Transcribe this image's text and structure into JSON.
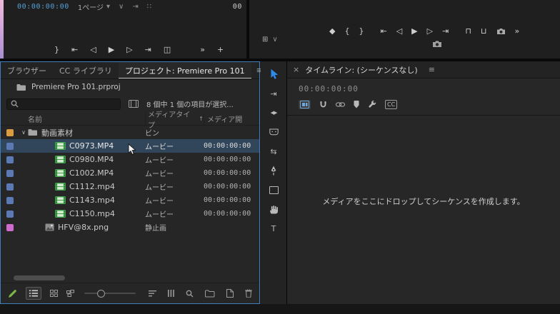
{
  "colors": {
    "accent": "#2d8ceb",
    "focus_border": "#3f7ebd",
    "timecode_blue": "#56a0d6",
    "selected_row": "#31465a",
    "swatch_bin": "#dd9b3f",
    "swatch_movie": "#5a79b5",
    "swatch_still": "#cf6bcf",
    "tool_green": "#7ab648"
  },
  "glyphs": {
    "chevron_down": "∨",
    "caret_down": "▾",
    "overflow": "»",
    "plus": "+",
    "menu": "≡",
    "close": "×",
    "brace_open": "{",
    "brace_close": "}",
    "go_to_in": "⇤",
    "go_to_out": "⇥",
    "step_back": "◁",
    "step_forward": "▷",
    "play": "▶",
    "marker": "◆",
    "lift": "⊓",
    "extract": "⊔",
    "insert": "◫",
    "grid": "⊞",
    "dots": "∷",
    "sort_up": "↑",
    "track_select": "⇥",
    "ripple": "◀▶",
    "slip": "⇆",
    "type_tool": "T"
  },
  "source_monitor": {
    "timecode": "00:00:00:00",
    "page_select": "1ページ",
    "duration": "00"
  },
  "project": {
    "tabs": [
      {
        "label": "ブラウザー"
      },
      {
        "label": "CC ライブラリ"
      },
      {
        "label": "プロジェクト: Premiere Pro 101"
      }
    ],
    "breadcrumb": "Premiere Pro 101.prproj",
    "search_value": "",
    "status": "8 個中 1 個の項目が選択...",
    "columns": {
      "name": "名前",
      "type": "メディアタイプ",
      "start": "メディア開"
    },
    "items": [
      {
        "label": "動画素材",
        "type": "ビン",
        "start": "",
        "kind": "bin",
        "swatch": "#dd9b3f",
        "selected": false
      },
      {
        "label": "C0973.MP4",
        "type": "ムービー",
        "start": "00:00:00:00",
        "kind": "movie",
        "swatch": "#5a79b5",
        "selected": true
      },
      {
        "label": "C0980.MP4",
        "type": "ムービー",
        "start": "00:00:00:00",
        "kind": "movie",
        "swatch": "#5a79b5",
        "selected": false
      },
      {
        "label": "C1002.MP4",
        "type": "ムービー",
        "start": "00:00:00:00",
        "kind": "movie",
        "swatch": "#5a79b5",
        "selected": false
      },
      {
        "label": "C1112.mp4",
        "type": "ムービー",
        "start": "00:00:00:00",
        "kind": "movie",
        "swatch": "#5a79b5",
        "selected": false
      },
      {
        "label": "C1143.mp4",
        "type": "ムービー",
        "start": "00:00:00:00",
        "kind": "movie",
        "swatch": "#5a79b5",
        "selected": false
      },
      {
        "label": "C1150.mp4",
        "type": "ムービー",
        "start": "00:00:00:00",
        "kind": "movie",
        "swatch": "#5a79b5",
        "selected": false
      },
      {
        "label": "HFV@8x.png",
        "type": "静止画",
        "start": "",
        "kind": "still",
        "swatch": "#cf6bcf",
        "selected": false
      }
    ]
  },
  "timeline": {
    "title": "タイムライン: (シーケンスなし)",
    "timecode": "00:00:00:00",
    "cc_label": "CC",
    "message": "メディアをここにドロップしてシーケンスを作成します。"
  }
}
